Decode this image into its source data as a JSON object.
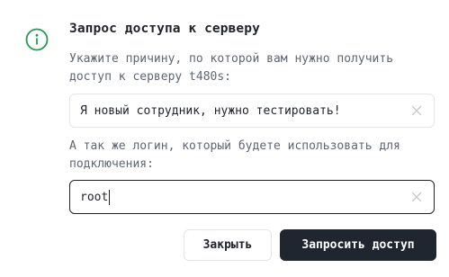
{
  "dialog": {
    "title": "Запрос доступа к серверу",
    "reason_description": "Укажите причину, по которой вам нужно получить доступ к серверу t480s:",
    "reason_value": "Я новый сотрудник, нужно тестировать!",
    "login_description": "А так же логин, который будете использовать для подключения:",
    "login_value": "root",
    "close_label": "Закрыть",
    "request_label": "Запросить доступ"
  },
  "icons": {
    "header": "info-icon",
    "clear": "close-icon"
  },
  "colors": {
    "info_icon": "#1f9d55",
    "primary_button": "#1f2630",
    "text": "#1f2328",
    "muted_text": "#5f6670"
  }
}
